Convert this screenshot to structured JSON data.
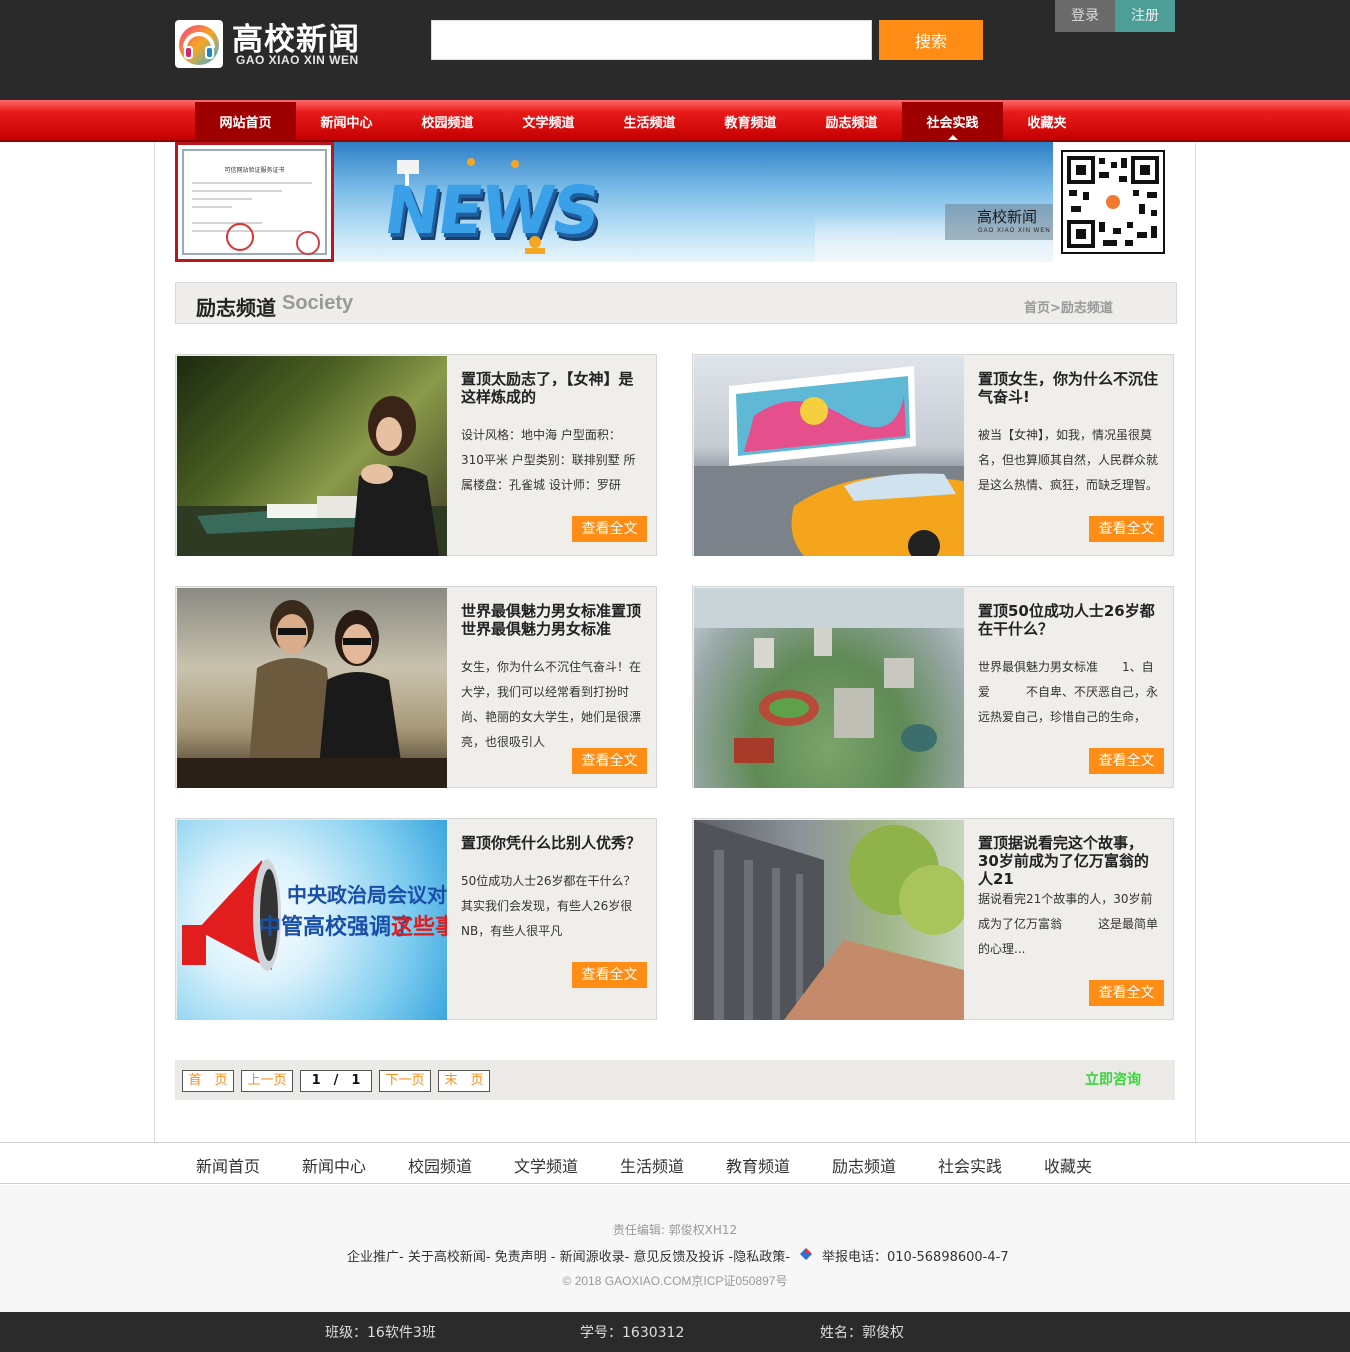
{
  "header": {
    "logo_title": "高校新闻",
    "logo_subtitle": "GAO XIAO XIN WEN",
    "search_placeholder": "",
    "search_button": "搜索",
    "login": "登录",
    "register": "注册"
  },
  "nav": {
    "items": [
      {
        "label": "网站首页"
      },
      {
        "label": "新闻中心"
      },
      {
        "label": "校园频道"
      },
      {
        "label": "文学频道"
      },
      {
        "label": "生活频道"
      },
      {
        "label": "教育频道"
      },
      {
        "label": "励志频道"
      },
      {
        "label": "社会实践"
      },
      {
        "label": "收藏夹"
      }
    ]
  },
  "banner": {
    "news_text": "NEWS",
    "label_cn": "高校新闻",
    "label_en": "GAO XIAO XIN WEN",
    "cert_title": "可信网站验证服务证书"
  },
  "section": {
    "title": "励志频道",
    "title_en": "Society",
    "breadcrumb": "首页>励志频道"
  },
  "articles": [
    {
      "title": "置顶太励志了，【女神】是这样炼成的",
      "desc": "设计风格：地中海 户型面积：310平米 户型类别：联排别墅 所属楼盘：孔雀城 设计师：罗研",
      "button": "查看全文"
    },
    {
      "title": "置顶女生，你为什么不沉住气奋斗!",
      "desc": "被当【女神】，如我，情况虽很莫名，但也算顺其自然，人民群众就是这么热情、疯狂，而缺乏理智。",
      "button": "查看全文"
    },
    {
      "title": "世界最俱魅力男女标准置顶世界最俱魅力男女标准",
      "desc": "女生，你为什么不沉住气奋斗！在大学，我们可以经常看到打扮时尚、艳丽的女大学生，她们是很漂亮，也很吸引人",
      "button": "查看全文"
    },
    {
      "title": "置顶50位成功人士26岁都在干什么？",
      "desc": "世界最俱魅力男女标准　　1、自爱　　　不自卑、不厌恶自己，永远热爱自己，珍惜自己的生命，",
      "button": "查看全文"
    },
    {
      "title": "置顶你凭什么比别人优秀？",
      "desc": "50位成功人士26岁都在干什么？其实我们会发现，有些人26岁很NB，有些人很平凡",
      "button": "查看全文",
      "image_text_1": "中央政治局会议对",
      "image_text_2": "中管高校强调了",
      "image_text_3": "这些事"
    },
    {
      "title": "置顶据说看完这个故事，30岁前成为了亿万富翁的人21",
      "desc": "据说看完21个故事的人，30岁前成为了亿万富翁　　　这是最简单的心理...",
      "button": "查看全文"
    }
  ],
  "pager": {
    "first": "首　页",
    "prev": "上一页",
    "page": "1　/　1",
    "next": "下一页",
    "last": "末　页",
    "consult": "立即咨询"
  },
  "footer": {
    "nav": [
      "新闻首页",
      "新闻中心",
      "校园频道",
      "文学频道",
      "生活频道",
      "教育频道",
      "励志频道",
      "社会实践",
      "收藏夹"
    ],
    "editor": "责任编辑: 郭俊权XH12",
    "links": "企业推广- 关于高校新闻- 免责声明 - 新闻源收录- 意见反馈及投诉 -隐私政策-",
    "report": "举报电话：010-56898600-4-7",
    "copyright": "© 2018 GAOXIAO.COM京ICP证050897号"
  },
  "student": {
    "class": "班级：16软件3班",
    "id": "学号：1630312",
    "name": "姓名：郭俊权"
  },
  "colors": {
    "accent": "#ff8c14",
    "nav_red": "#d40000",
    "header_bg": "#2a2a2a",
    "consult_green": "#3cd43c"
  }
}
